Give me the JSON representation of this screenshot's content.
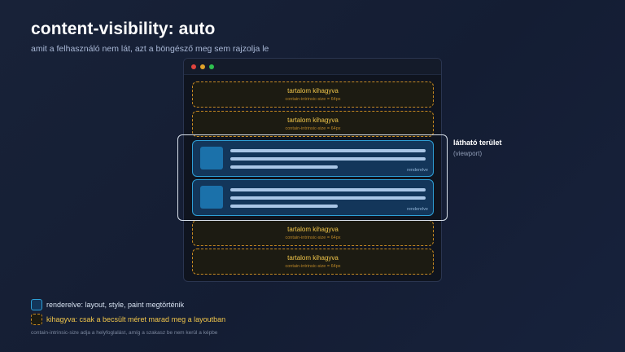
{
  "header": {
    "title": "content-visibility: auto",
    "subtitle": "amit a felhasználó nem lát, azt a böngésző meg sem rajzolja le"
  },
  "blocks": {
    "skipped": {
      "label": "tartalom kihagyva",
      "sublabel": "contain-intrinsic-size = 64px"
    },
    "rendered": {
      "label": "renderelve"
    }
  },
  "viewport": {
    "label": "látható terület",
    "sublabel": "(viewport)"
  },
  "legend": {
    "rendered": "renderelve: layout, style, paint megtörténik",
    "skipped": "kihagyva: csak a becsült méret marad meg a layoutban",
    "note": "contain-intrinsic-size adja a helyfoglalást, amíg a szakasz be nem kerül a képbe"
  },
  "colors": {
    "rendered_border": "#2e9fd6",
    "skipped_border": "#c88a22",
    "skipped_text": "#f0c54a",
    "viewport_border": "#d8e0ea"
  }
}
